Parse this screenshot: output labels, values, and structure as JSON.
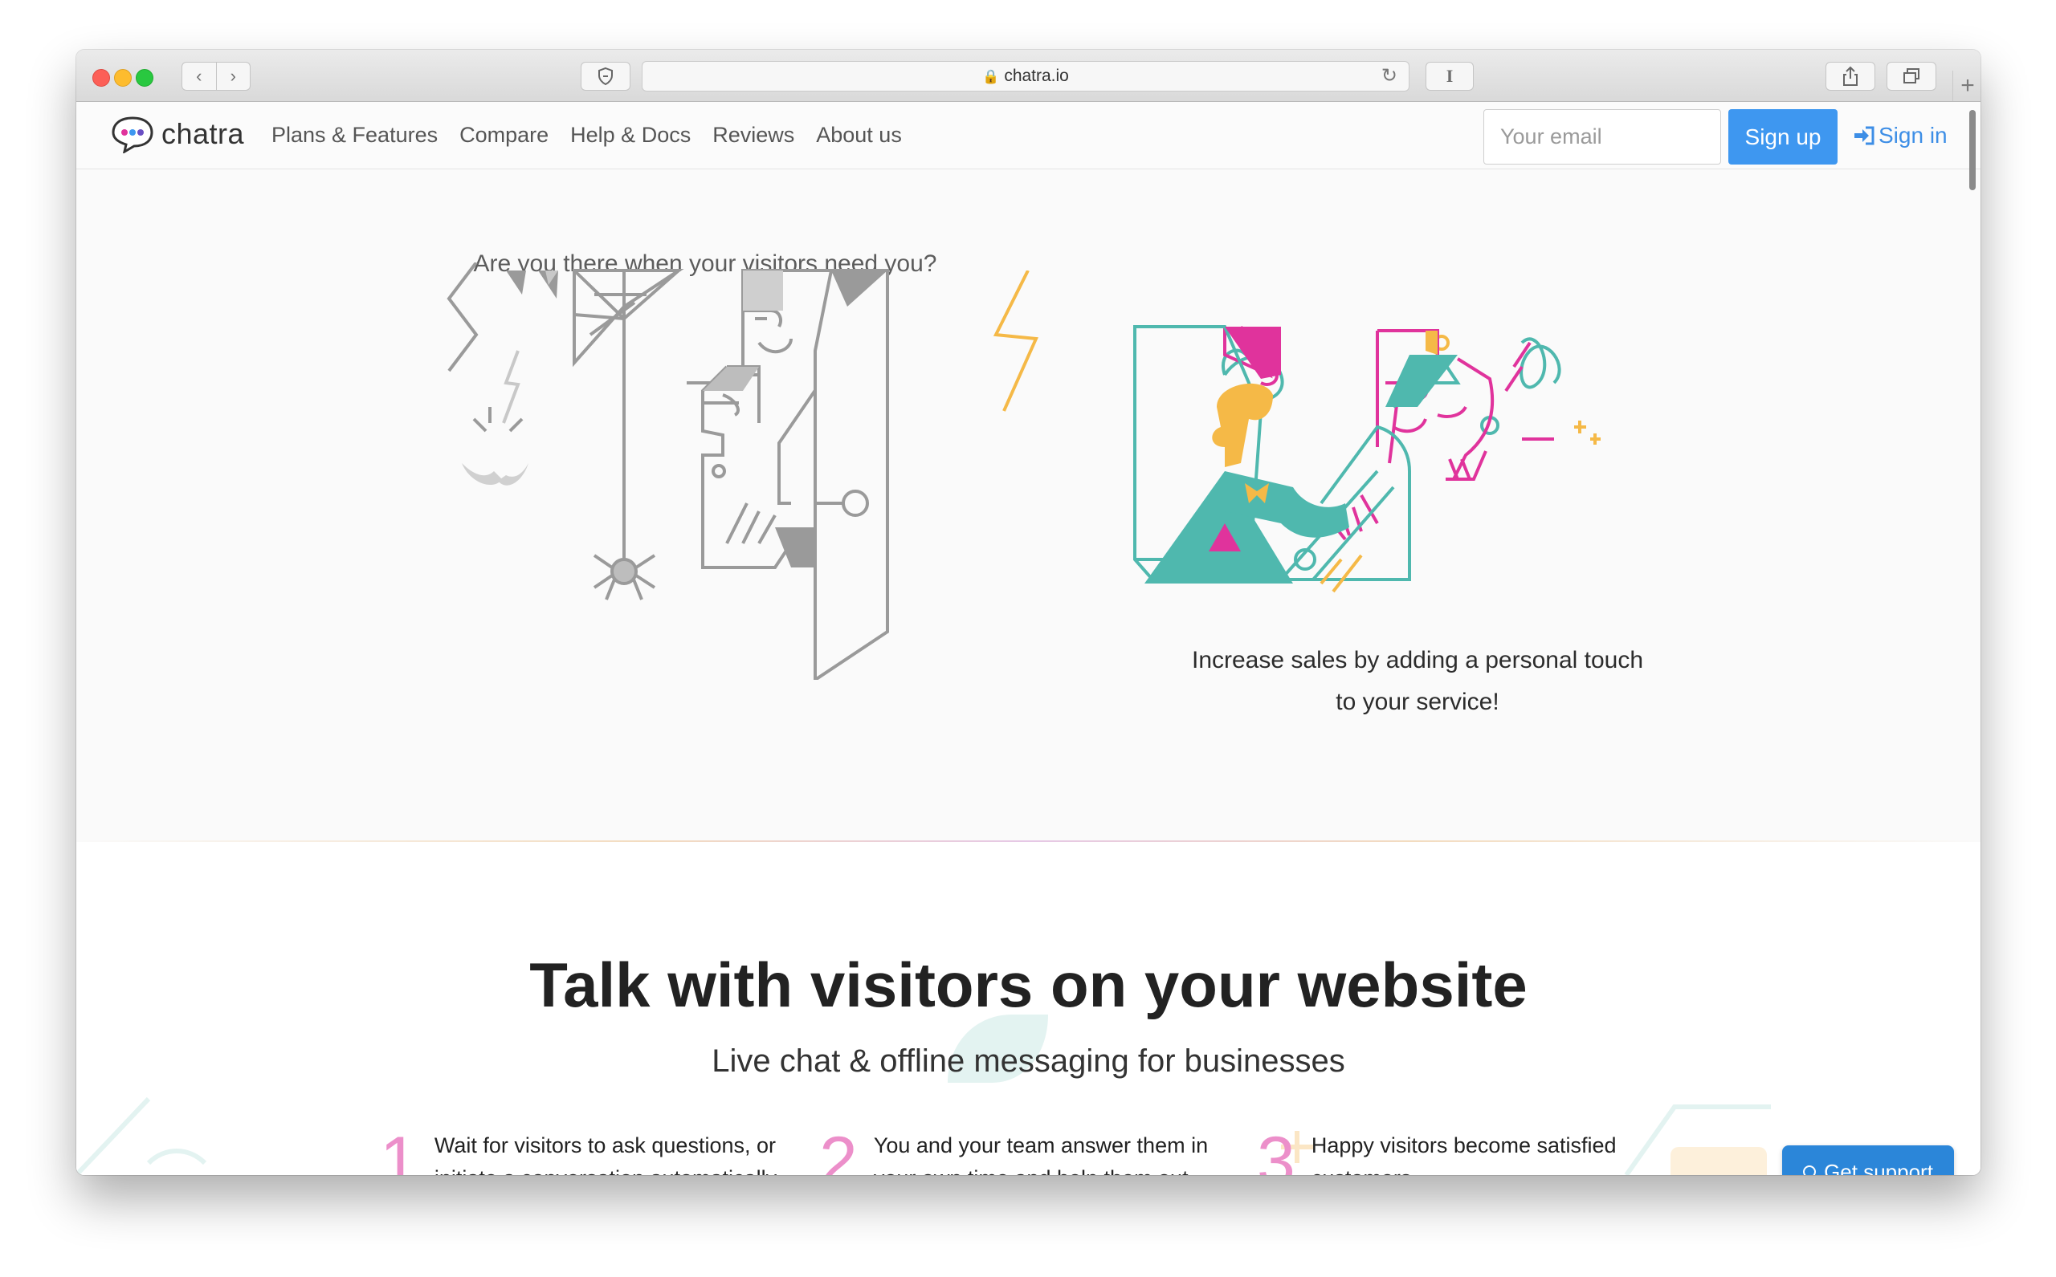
{
  "browser": {
    "url": "chatra.io",
    "back_glyph": "‹",
    "forward_glyph": "›",
    "reader_glyph": "I",
    "new_tab_glyph": "+"
  },
  "site": {
    "brand": "chatra",
    "nav": [
      {
        "label": "Plans & Features"
      },
      {
        "label": "Compare"
      },
      {
        "label": "Help & Docs"
      },
      {
        "label": "Reviews"
      },
      {
        "label": "About us"
      }
    ],
    "email_placeholder": "Your email",
    "signup_label": "Sign up",
    "signin_label": "Sign in"
  },
  "hero": {
    "question": "Are you there when your visitors need you?",
    "caption_line1": "Increase sales by adding a personal touch",
    "caption_line2": "to your service!"
  },
  "features": {
    "title": "Talk with visitors on your website",
    "subtitle": "Live chat & offline messaging for businesses",
    "steps": [
      {
        "num": "1",
        "text": "Wait for visitors to ask questions, or initiate a conversation automatically"
      },
      {
        "num": "2",
        "text": "You and your team answer them in your own time and help them out"
      },
      {
        "num": "3",
        "text": "Happy visitors become satisfied customers"
      }
    ]
  },
  "support": {
    "label": "Get support"
  },
  "colors": {
    "accent_blue": "#3e97f0",
    "signin_blue": "#3d8ee6",
    "support_blue": "#2b86d9",
    "step_pink": "#ec8fca",
    "art_teal": "#4fb8ae",
    "art_pink": "#e0339c",
    "art_yellow": "#f5b947"
  }
}
